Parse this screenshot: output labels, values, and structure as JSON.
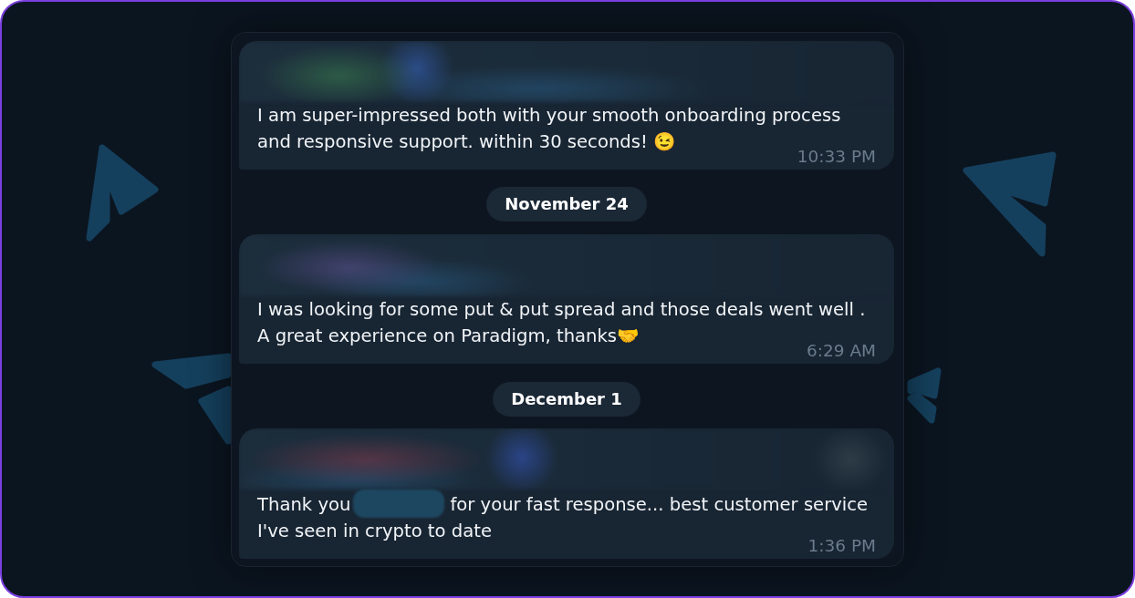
{
  "chat": [
    {
      "kind": "message",
      "parts": [
        {
          "kind": "text",
          "text": "I am super-impressed both with your smooth onboarding process and responsive support. within 30 seconds! 😉"
        }
      ],
      "time": "10:33 PM"
    },
    {
      "kind": "date",
      "label": "November 24"
    },
    {
      "kind": "message",
      "parts": [
        {
          "kind": "text",
          "text": "I was looking for some put & put spread and those deals went well . A great experience on Paradigm, thanks🤝"
        }
      ],
      "time": "6:29 AM"
    },
    {
      "kind": "date",
      "label": "December 1"
    },
    {
      "kind": "message",
      "parts": [
        {
          "kind": "text",
          "text": "Thank you"
        },
        {
          "kind": "redacted"
        },
        {
          "kind": "text",
          "text": "for your fast response... best customer service"
        },
        {
          "kind": "text",
          "text": "I've seen in crypto to date"
        }
      ],
      "time": "1:36 PM"
    }
  ]
}
